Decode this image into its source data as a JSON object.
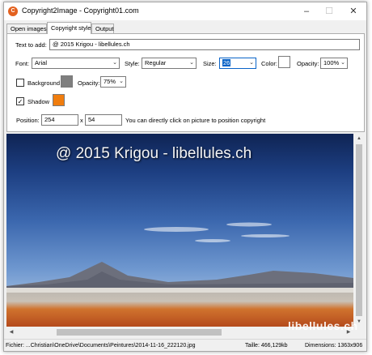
{
  "window": {
    "title": "Copyright2Image - Copyright01.com",
    "minimize": "–",
    "maximize": "☐",
    "close": "✕"
  },
  "tabs": [
    "Open images",
    "Copyright style",
    "Output"
  ],
  "active_tab": "Copyright style",
  "form": {
    "text_label": "Text to add:",
    "text_value": "@ 2015 Krigou - libellules.ch",
    "font_label": "Font:",
    "font_value": "Arial",
    "style_label": "Style:",
    "style_value": "Regular",
    "size_label": "Size:",
    "size_value": "26",
    "color_label": "Color:",
    "color_value": "#ffffff",
    "opacity_label": "Opacity:",
    "opacity_value": "100%",
    "background_label": "Background",
    "background_checked": false,
    "background_color": "#7f7f7f",
    "bg_opacity_label": "Opacity:",
    "bg_opacity_value": "75%",
    "shadow_label": "Shadow",
    "shadow_checked": true,
    "shadow_color": "#f07d0e",
    "position_label": "Position:",
    "position_x": "254",
    "position_sep": "x",
    "position_y": "54",
    "position_hint": "You can directly click on picture to position copyright"
  },
  "preview": {
    "overlay_text": "@ 2015 Krigou - libellules.ch"
  },
  "status": {
    "file": "Fichier: ...Christian\\OneDrive\\Documents\\Peintures\\2014-11-16_222120.jpg",
    "size": "Taille: 466,129kb",
    "dimensions": "Dimensions: 1363x906"
  },
  "watermark": "libellules.ch",
  "icons": {
    "app": "copyright-app-icon",
    "dropdown": "chevron-down-icon",
    "checkmark": "checkmark-icon"
  }
}
